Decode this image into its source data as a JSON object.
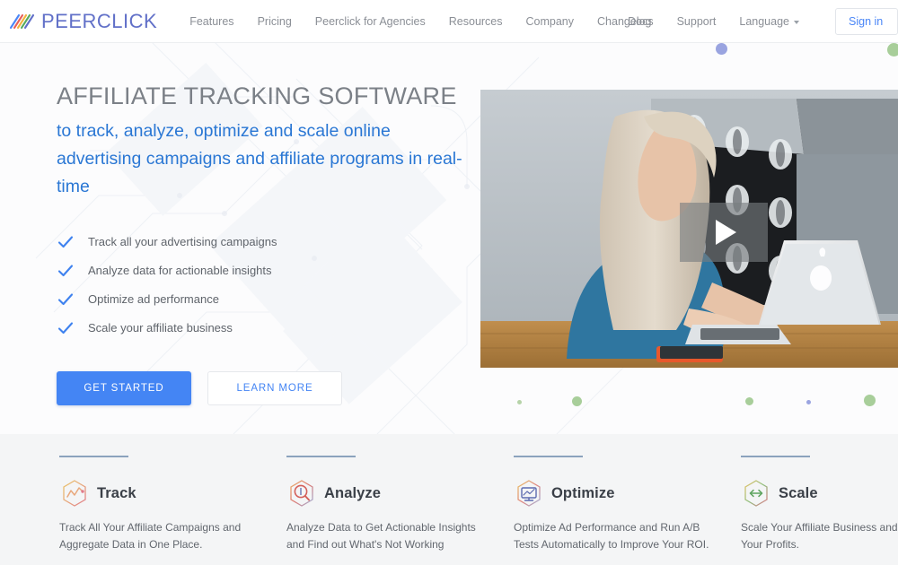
{
  "brand": {
    "name": "PEERCLICK",
    "mark_icon": "peerclick-stripes-logo"
  },
  "nav": {
    "main": [
      {
        "label": "Features"
      },
      {
        "label": "Pricing"
      },
      {
        "label": "Peerclick for Agencies"
      },
      {
        "label": "Resources"
      },
      {
        "label": "Company"
      },
      {
        "label": "Changelog"
      }
    ],
    "right": [
      {
        "label": "Docs"
      },
      {
        "label": "Support"
      },
      {
        "label": "Language",
        "caret_icon": "chevron-down-icon"
      }
    ],
    "signin_label": "Sign in"
  },
  "hero": {
    "title": "AFFILIATE TRACKING SOFTWARE",
    "subtitle": "to track, analyze, optimize and scale online advertising campaigns and affiliate programs in real-time",
    "checks": [
      {
        "label": "Track all your advertising campaigns",
        "icon": "check-icon"
      },
      {
        "label": "Analyze data for actionable insights",
        "icon": "check-icon"
      },
      {
        "label": "Optimize ad performance",
        "icon": "check-icon"
      },
      {
        "label": "Scale your affiliate business",
        "icon": "check-icon"
      }
    ],
    "primary_button": "GET STARTED",
    "secondary_button": "LEARN MORE",
    "video": {
      "play_icon": "play-triangle-icon",
      "alt": "Woman working on a laptop at a wooden desk"
    }
  },
  "features": [
    {
      "title": "Track",
      "desc": "Track All Your Affiliate Campaigns and Aggregate Data in One Place.",
      "icon": "track-hexagon-chart-icon"
    },
    {
      "title": "Analyze",
      "desc": "Analyze Data to Get Actionable Insights and Find out What's Not Working",
      "icon": "analyze-hexagon-magnifier-icon"
    },
    {
      "title": "Optimize",
      "desc": "Optimize Ad Performance and Run A/B Tests Automatically to Improve Your ROI.",
      "icon": "optimize-hexagon-monitor-icon"
    },
    {
      "title": "Scale",
      "desc": "Scale Your Affiliate Business and Multiply Your Profits.",
      "icon": "scale-hexagon-arrows-icon"
    }
  ],
  "colors": {
    "brand_purple": "#6170c8",
    "accent_blue": "#4485f4",
    "heading_gray": "#7b8087",
    "subtitle_blue": "#2a77d4",
    "feature_rule": "#8ba2bd",
    "features_bg": "#f4f5f6",
    "dot_green": "#a8ce9a",
    "dot_purple": "#9aa4e0"
  }
}
